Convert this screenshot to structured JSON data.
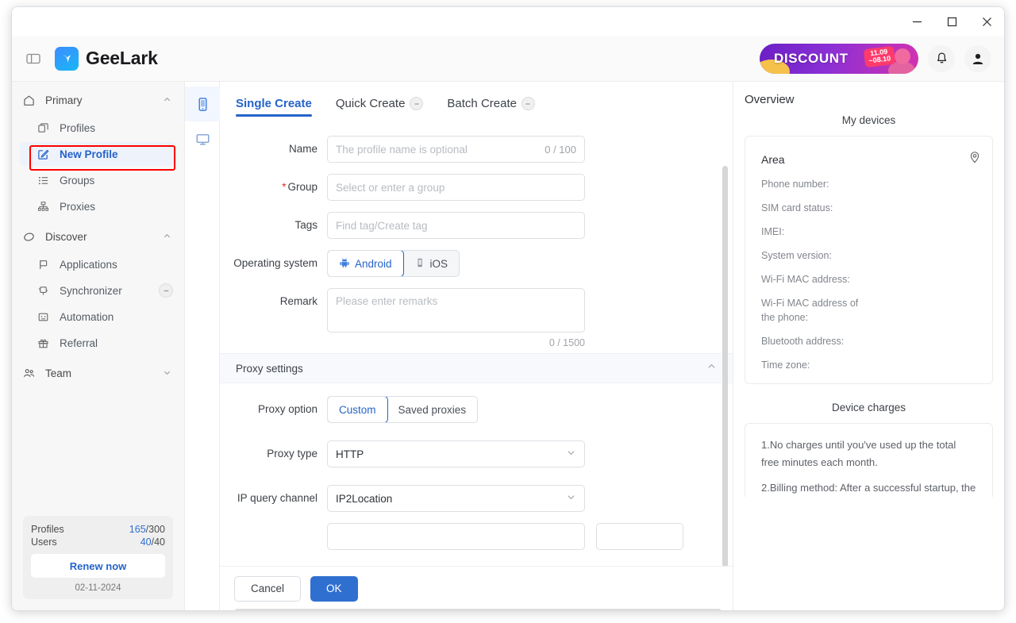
{
  "window": {
    "controls": {
      "minimize": "minimize-icon",
      "maximize": "maximize-icon",
      "close": "close-icon"
    }
  },
  "header": {
    "panel_toggle_icon": "panel-toggle-icon",
    "brand_name": "GeeLark",
    "promo": {
      "label": "DISCOUNT",
      "date_start": "11.09",
      "date_end": "~08.10"
    },
    "notification_icon": "bell-icon",
    "account_icon": "user-avatar-icon"
  },
  "sidebar": {
    "groups": [
      {
        "label": "Primary",
        "icon": "home-icon",
        "caret": "chevron-up-icon",
        "items": [
          {
            "label": "Profiles",
            "icon": "profiles-icon",
            "selected": false
          },
          {
            "label": "New Profile",
            "icon": "edit-square-icon",
            "selected": true
          },
          {
            "label": "Groups",
            "icon": "list-icon",
            "selected": false
          },
          {
            "label": "Proxies",
            "icon": "network-icon",
            "selected": false
          }
        ]
      },
      {
        "label": "Discover",
        "icon": "compass-icon",
        "caret": "chevron-up-icon",
        "items": [
          {
            "label": "Applications",
            "icon": "applications-icon",
            "selected": false
          },
          {
            "label": "Synchronizer",
            "icon": "sync-icon",
            "selected": false,
            "badge": "collapse-badge-icon"
          },
          {
            "label": "Automation",
            "icon": "automation-icon",
            "selected": false
          },
          {
            "label": "Referral",
            "icon": "gift-icon",
            "selected": false
          }
        ]
      },
      {
        "label": "Team",
        "icon": "team-icon",
        "caret": "chevron-down-icon",
        "items": []
      }
    ],
    "quota": {
      "profiles_label": "Profiles",
      "profiles_used": "165",
      "profiles_total": "/300",
      "users_label": "Users",
      "users_used": "40",
      "users_total": "/40",
      "renew_label": "Renew now",
      "date": "02-11-2024"
    }
  },
  "device_rail": {
    "items": [
      {
        "icon": "phone-icon",
        "active": true
      },
      {
        "icon": "monitor-icon",
        "active": false
      }
    ]
  },
  "main": {
    "tabs": [
      {
        "label": "Single Create",
        "active": true,
        "badge": null
      },
      {
        "label": "Quick Create",
        "active": false,
        "badge": "collapse-badge-icon"
      },
      {
        "label": "Batch Create",
        "active": false,
        "badge": "collapse-badge-icon"
      }
    ],
    "fields": {
      "name_label": "Name",
      "name_placeholder": "The profile name is optional",
      "name_counter": "0 / 100",
      "group_label": "Group",
      "group_required": "*",
      "group_placeholder": "Select or enter a group",
      "tags_label": "Tags",
      "tags_placeholder": "Find tag/Create tag",
      "os_label": "Operating system",
      "os_android": "Android",
      "os_ios": "iOS",
      "remark_label": "Remark",
      "remark_placeholder": "Please enter remarks",
      "remark_counter": "0 / 1500"
    },
    "proxy_section": {
      "title": "Proxy settings",
      "caret": "chevron-up-icon",
      "option_label": "Proxy option",
      "option_custom": "Custom",
      "option_saved": "Saved proxies",
      "type_label": "Proxy type",
      "type_value": "HTTP",
      "channel_label": "IP query channel",
      "channel_value": "IP2Location"
    },
    "actions": {
      "cancel_label": "Cancel",
      "ok_label": "OK"
    }
  },
  "overview": {
    "title": "Overview",
    "devices_section_title": "My devices",
    "area_label": "Area",
    "pin_icon": "location-pin-icon",
    "spec_lines": [
      "Phone number:",
      "SIM card status:",
      "IMEI:",
      "System version:",
      "Wi-Fi MAC address:",
      "Wi-Fi MAC address of the phone:",
      "Bluetooth address:",
      "Time zone:"
    ],
    "charges_section_title": "Device charges",
    "charges_paragraphs": [
      "1.No charges until you've used up the total free minutes each month.",
      "2.Billing method: After a successful startup, the"
    ]
  },
  "colors": {
    "accent": "#2563c9",
    "primary_button": "#2f6fd0",
    "highlight_box": "#ff0000",
    "required_star": "#d93026"
  }
}
